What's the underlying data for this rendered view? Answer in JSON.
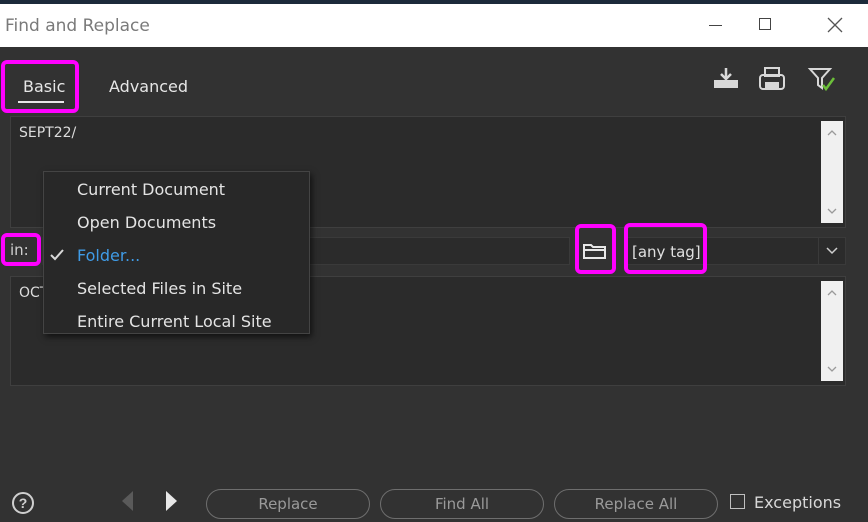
{
  "window": {
    "title": "Find and Replace"
  },
  "tabs": [
    {
      "label": "Basic",
      "active": true
    },
    {
      "label": "Advanced",
      "active": false
    }
  ],
  "toolbar": {
    "icons": [
      "download-icon",
      "save-icon",
      "filter-check-icon"
    ]
  },
  "find": {
    "value": "SEPT22/"
  },
  "scope": {
    "label": "in:",
    "folder_path": "",
    "tag_select_value": "[any tag]"
  },
  "scope_menu": {
    "items": [
      {
        "label": "Current Document",
        "checked": false
      },
      {
        "label": "Open Documents",
        "checked": false
      },
      {
        "label": "Folder...",
        "checked": true
      },
      {
        "label": "Selected Files in Site",
        "checked": false
      },
      {
        "label": "Entire Current Local Site",
        "checked": false
      }
    ]
  },
  "replace": {
    "value": "OCT"
  },
  "footer": {
    "help": "?",
    "replace_label": "Replace",
    "find_all_label": "Find All",
    "replace_all_label": "Replace All",
    "exceptions_label": "Exceptions",
    "exceptions_checked": false
  },
  "colors": {
    "highlight": "#ff00ff",
    "background": "#323232",
    "selected_item": "#3f9be6"
  }
}
